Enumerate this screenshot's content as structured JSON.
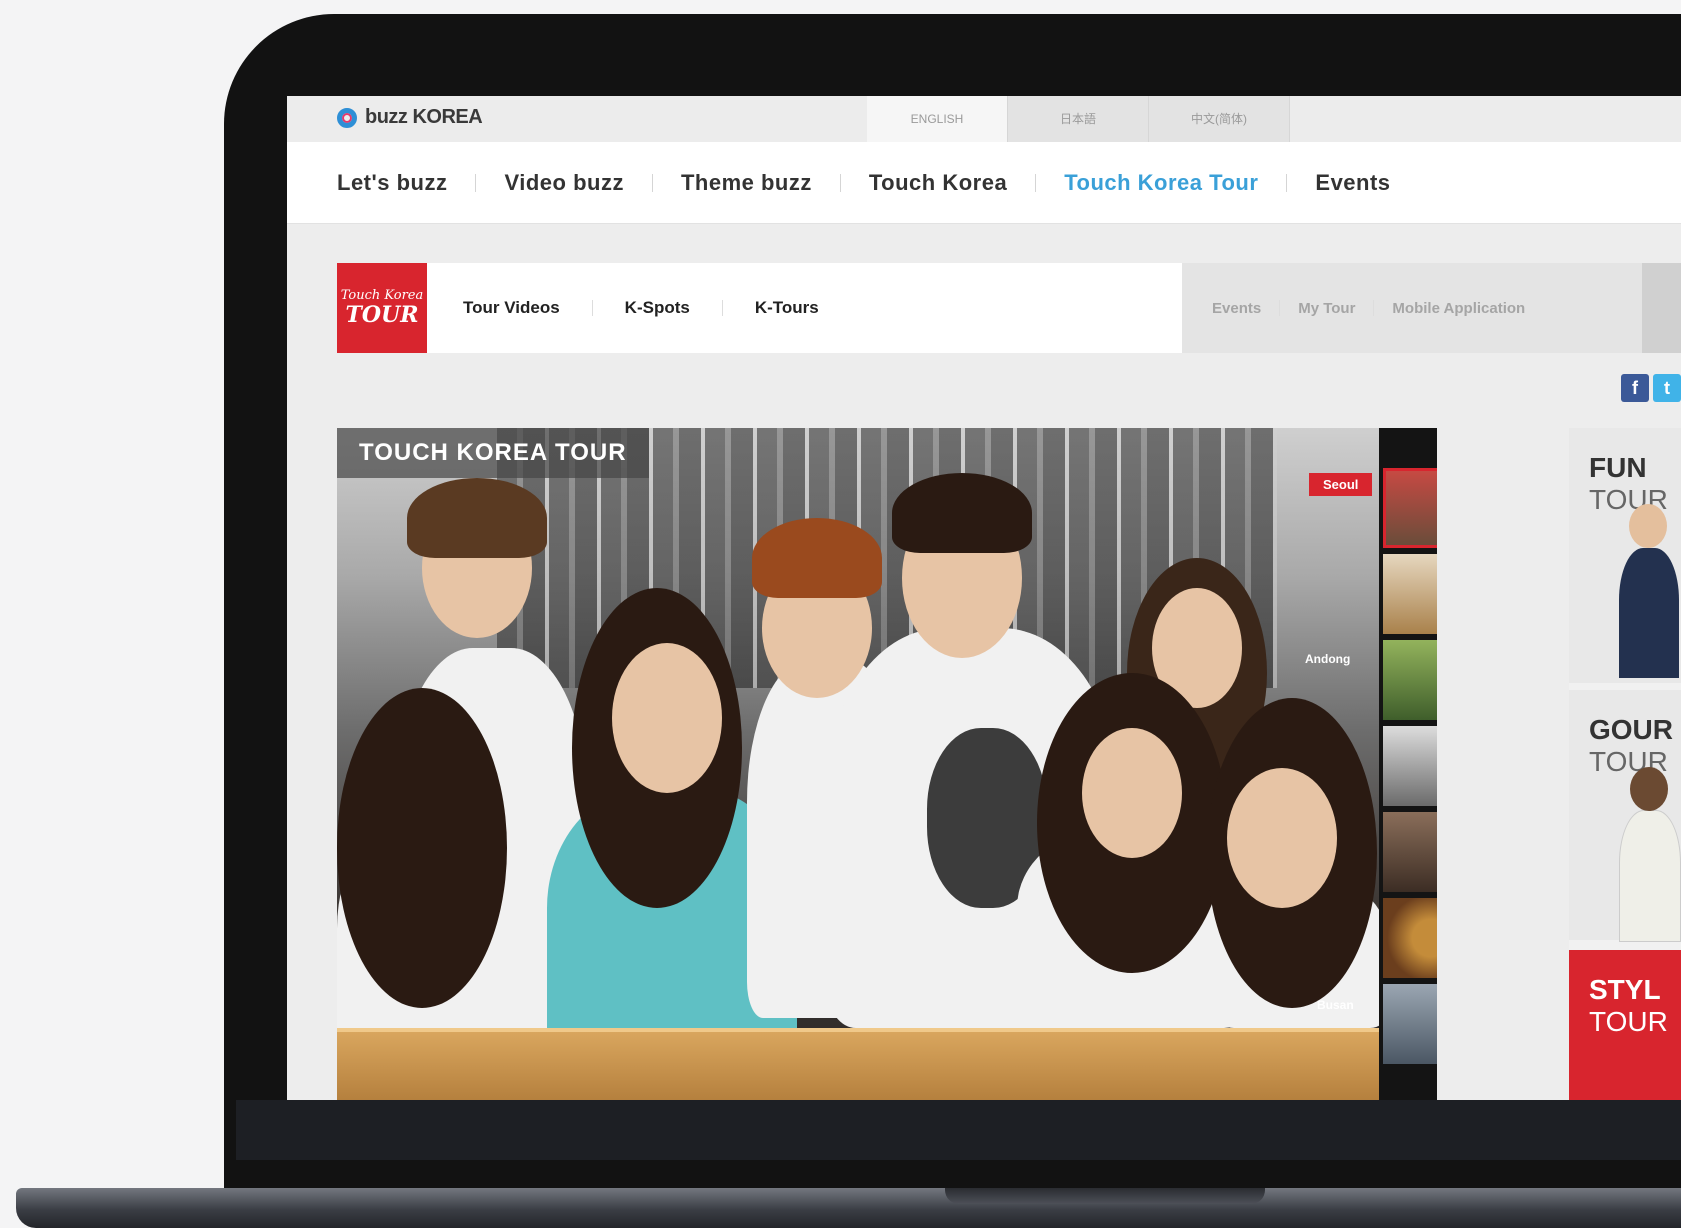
{
  "site": {
    "logo_text": "buzz KOREA"
  },
  "languages": [
    "ENGLISH",
    "日本語",
    "中文(简体)"
  ],
  "main_nav": [
    {
      "label": "Let's buzz",
      "active": false
    },
    {
      "label": "Video buzz",
      "active": false
    },
    {
      "label": "Theme buzz",
      "active": false
    },
    {
      "label": "Touch Korea",
      "active": false
    },
    {
      "label": "Touch Korea Tour",
      "active": true
    },
    {
      "label": "Events",
      "active": false
    }
  ],
  "sub_nav": {
    "logo_line1": "Touch Korea",
    "logo_line2": "TOUR",
    "left": [
      "Tour Videos",
      "K-Spots",
      "K-Tours"
    ],
    "right": [
      "Events",
      "My Tour",
      "Mobile Application"
    ]
  },
  "hero": {
    "title": "TOUCH KOREA TOUR",
    "tag": "Seoul",
    "labels": [
      "Andong",
      "Busan"
    ]
  },
  "side_cards": [
    {
      "line1": "FUN",
      "line2": "TOUR"
    },
    {
      "line1": "GOUR",
      "line2": "TOUR"
    },
    {
      "line1": "STYL",
      "line2": "TOUR"
    }
  ],
  "social": {
    "facebook": "f",
    "twitter": "t"
  },
  "colors": {
    "accent_blue": "#3aa0d8",
    "brand_red": "#d8252e"
  }
}
